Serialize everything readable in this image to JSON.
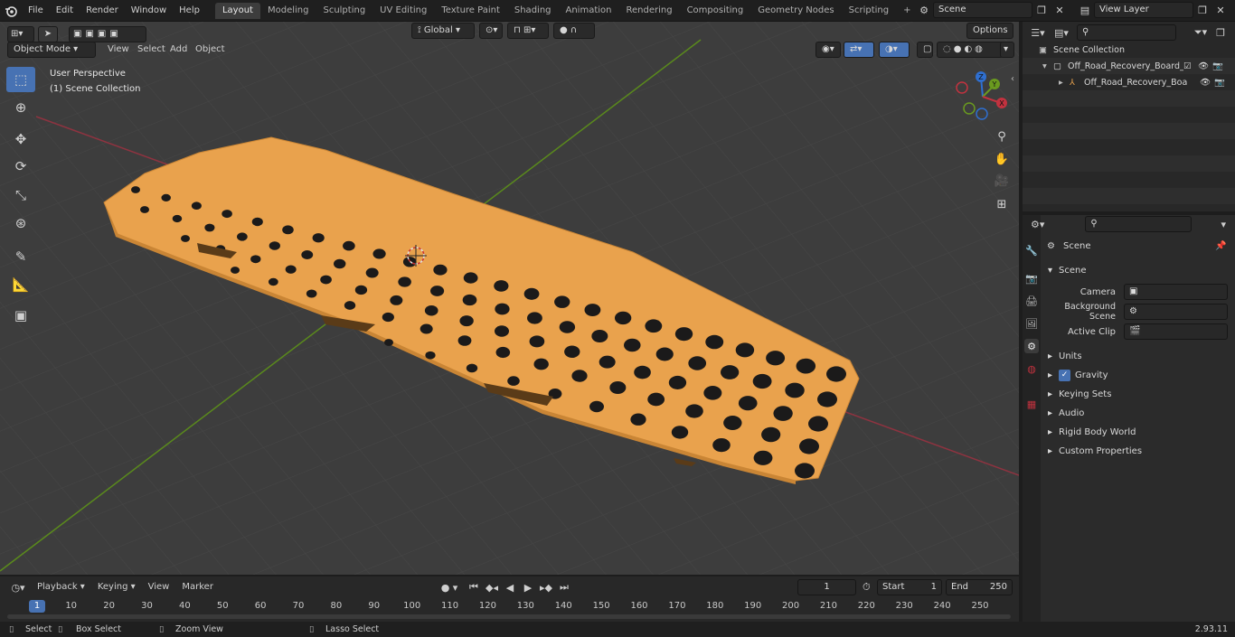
{
  "app": {
    "version": "2.93.11"
  },
  "menu": [
    "File",
    "Edit",
    "Render",
    "Window",
    "Help"
  ],
  "workspaces": [
    "Layout",
    "Modeling",
    "Sculpting",
    "UV Editing",
    "Texture Paint",
    "Shading",
    "Animation",
    "Rendering",
    "Compositing",
    "Geometry Nodes",
    "Scripting"
  ],
  "active_workspace": "Layout",
  "scene_field": "Scene",
  "view_layer_field": "View Layer",
  "viewport": {
    "mode": "Object Mode",
    "menus": [
      "View",
      "Select",
      "Add",
      "Object"
    ],
    "orientation": "Global",
    "options_label": "Options",
    "overlay_title": "User Perspective",
    "overlay_subtitle": "(1) Scene Collection",
    "gizmo": {
      "x": "X",
      "y": "Y",
      "z": "Z"
    },
    "tools": [
      "select-box",
      "cursor",
      "move",
      "rotate",
      "scale",
      "transform",
      "annotate",
      "measure",
      "add-cube"
    ]
  },
  "outliner": {
    "root": "Scene Collection",
    "items": [
      {
        "name": "Off_Road_Recovery_Board_C"
      },
      {
        "name": "Off_Road_Recovery_Boa"
      }
    ]
  },
  "properties": {
    "context_title": "Scene",
    "panel_title": "Scene",
    "camera_label": "Camera",
    "background_label": "Background Scene",
    "active_clip_label": "Active Clip",
    "sections": [
      "Units",
      "Gravity",
      "Keying Sets",
      "Audio",
      "Rigid Body World",
      "Custom Properties"
    ],
    "gravity_checked": true
  },
  "timeline": {
    "menus": [
      "Playback",
      "Keying",
      "View",
      "Marker"
    ],
    "current_frame": "1",
    "start_label": "Start",
    "start": "1",
    "end_label": "End",
    "end": "250",
    "ruler": [
      "1",
      "10",
      "20",
      "30",
      "40",
      "50",
      "60",
      "70",
      "80",
      "90",
      "100",
      "110",
      "120",
      "130",
      "140",
      "150",
      "160",
      "170",
      "180",
      "190",
      "200",
      "210",
      "220",
      "230",
      "240",
      "250"
    ]
  },
  "status": {
    "select": "Select",
    "box_select": "Box Select",
    "zoom_view": "Zoom View",
    "lasso_select": "Lasso Select"
  },
  "colors": {
    "accent": "#4772b3",
    "board": "#e9a24d",
    "x_axis": "#c2323f",
    "y_axis": "#6a9a1f"
  }
}
